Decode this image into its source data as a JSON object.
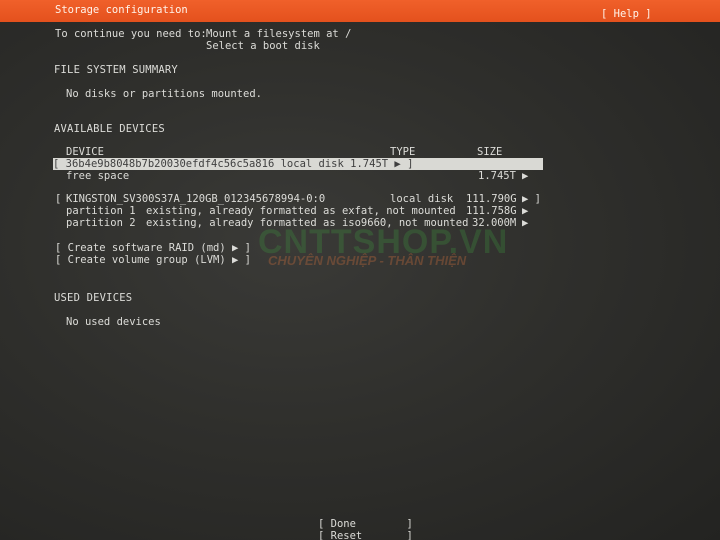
{
  "header": {
    "title": "Storage configuration",
    "help": "[ Help ]"
  },
  "intro": {
    "prefix": "To continue you need to:",
    "line1": "Mount a filesystem at /",
    "line2": "Select a boot disk"
  },
  "fs_summary": {
    "heading": "FILE SYSTEM SUMMARY",
    "empty": "No disks or partitions mounted."
  },
  "available": {
    "heading": "AVAILABLE DEVICES",
    "columns": {
      "device": "DEVICE",
      "type": "TYPE",
      "size": "SIZE"
    },
    "disk1": {
      "open": "[",
      "name": "36b4e9b8048b7b20030efdf4c56c5a816",
      "type": "local disk",
      "size": "1.745T",
      "arrow": "▶ ]",
      "sub": {
        "name": "free space",
        "size": "1.745T",
        "arrow": "▶"
      }
    },
    "disk2": {
      "open": "[",
      "name": "KINGSTON_SV300S37A_120GB_012345678994-0:0",
      "type": "local disk",
      "size": "111.790G",
      "arrow": "▶ ]",
      "partitions": [
        {
          "name": "partition 1",
          "desc": "existing, already formatted as exfat, not mounted",
          "size": "111.758G",
          "arrow": "▶"
        },
        {
          "name": "partition 2",
          "desc": "existing, already formatted as iso9660, not mounted",
          "size": "32.000M",
          "arrow": "▶"
        }
      ]
    },
    "actions": {
      "raid": "[ Create software RAID (md) ▶ ]",
      "lvm": "[ Create volume group (LVM) ▶ ]"
    }
  },
  "used": {
    "heading": "USED DEVICES",
    "empty": "No used devices"
  },
  "buttons": {
    "done": "[ Done        ]",
    "reset": "[ Reset       ]"
  },
  "watermark": {
    "logo": "CNTTSHOP.VN",
    "tagline": "CHUYÊN NGHIỆP - THÂN THIỆN"
  },
  "colors": {
    "header_bg": "#e95420",
    "background": "#2b2b29",
    "text": "#dcdcd8",
    "selection_bg": "#d9d9d4"
  }
}
